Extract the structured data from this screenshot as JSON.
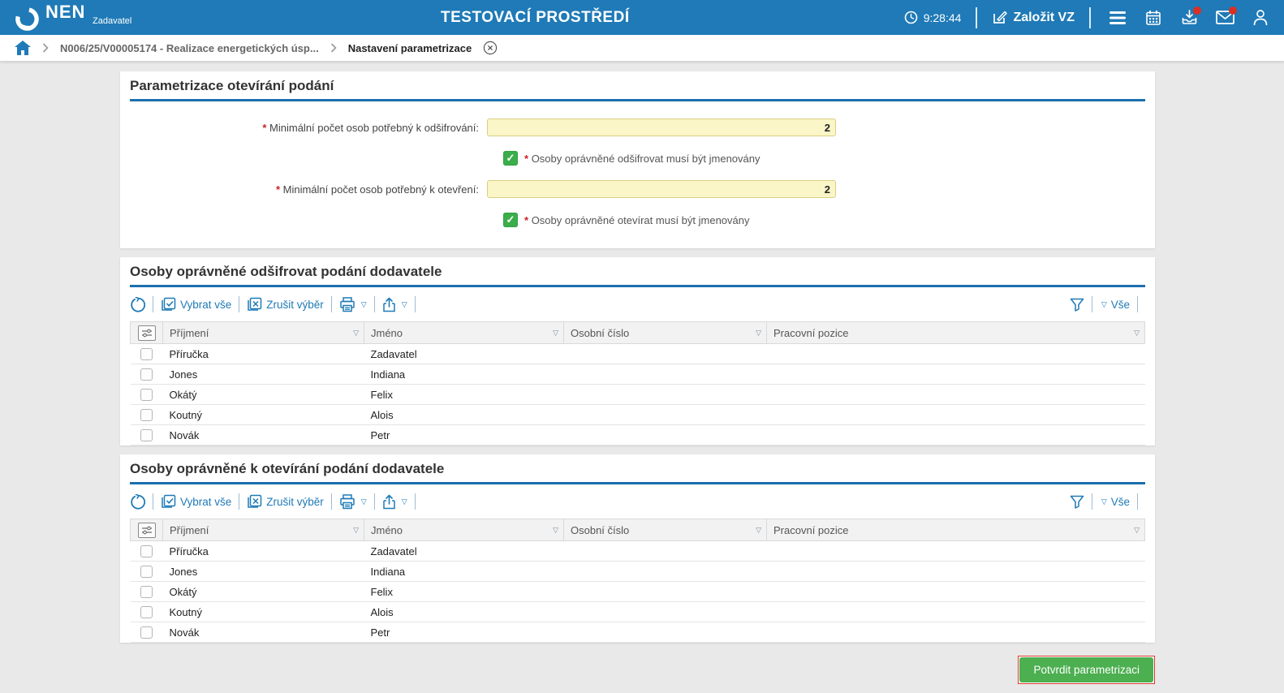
{
  "header": {
    "brand": "NEN",
    "brand_sub": "Zadavatel",
    "env_title": "TESTOVACÍ PROSTŘEDÍ",
    "time": "9:28:44",
    "create_vz_label": "Založit VZ",
    "icons": [
      "clock-icon",
      "edit-icon",
      "hamburger-menu-icon",
      "calendar-icon",
      "download-icon",
      "mail-icon",
      "user-icon"
    ],
    "notification_dot_color": "#d93025"
  },
  "breadcrumb": {
    "home_icon": "home-icon",
    "item": "N006/25/V00005174 - Realizace energetických úsp...",
    "active": "Nastavení parametrizace",
    "close_icon": "circle-x-icon"
  },
  "form": {
    "title": "Parametrizace otevírání podání",
    "required_mark": "*",
    "field_decrypt": {
      "label": "Minimální počet osob potřebný k odšifrování:",
      "value": "2"
    },
    "checkbox_decrypt": {
      "label": "Osoby oprávněné odšifrovat musí být jmenovány",
      "checked": true,
      "check_glyph": "✓"
    },
    "field_open": {
      "label": "Minimální počet osob potřebný k otevření:",
      "value": "2"
    },
    "checkbox_open": {
      "label": "Osoby oprávněné otevírat musí být jmenovány",
      "checked": true,
      "check_glyph": "✓"
    }
  },
  "toolbar": {
    "select_all": "Vybrat vše",
    "clear_selection": "Zrušit výběr",
    "filter_all": "Vše",
    "caret": "▽",
    "icons": [
      "refresh-icon",
      "select-all-icon",
      "clear-selection-icon",
      "print-icon",
      "export-icon",
      "filter-funnel-icon"
    ]
  },
  "tables": [
    {
      "title": "Osoby oprávněné odšifrovat podání dodavatele",
      "columns": [
        "Příjmení",
        "Jméno",
        "Osobní číslo",
        "Pracovní pozice"
      ],
      "rows": [
        [
          "Příručka",
          "Zadavatel",
          "",
          ""
        ],
        [
          "Jones",
          "Indiana",
          "",
          ""
        ],
        [
          "Okátý",
          "Felix",
          "",
          ""
        ],
        [
          "Koutný",
          "Alois",
          "",
          ""
        ],
        [
          "Novák",
          "Petr",
          "",
          ""
        ]
      ]
    },
    {
      "title": "Osoby oprávněné k otevírání podání dodavatele",
      "columns": [
        "Příjmení",
        "Jméno",
        "Osobní číslo",
        "Pracovní pozice"
      ],
      "rows": [
        [
          "Příručka",
          "Zadavatel",
          "",
          ""
        ],
        [
          "Jones",
          "Indiana",
          "",
          ""
        ],
        [
          "Okátý",
          "Felix",
          "",
          ""
        ],
        [
          "Koutný",
          "Alois",
          "",
          ""
        ],
        [
          "Novák",
          "Petr",
          "",
          ""
        ]
      ]
    }
  ],
  "footer": {
    "confirm_label": "Potvrdit parametrizaci"
  },
  "colors": {
    "topbar": "#1f7ab7",
    "accent_blue": "#1f7ab7",
    "section_underline": "#1a6fad",
    "input_bg": "#faf6c8",
    "checkbox_green": "#3bad4a",
    "button_green": "#4caf50",
    "button_focus_red": "#e03a2f",
    "badge_red": "#d93025"
  }
}
